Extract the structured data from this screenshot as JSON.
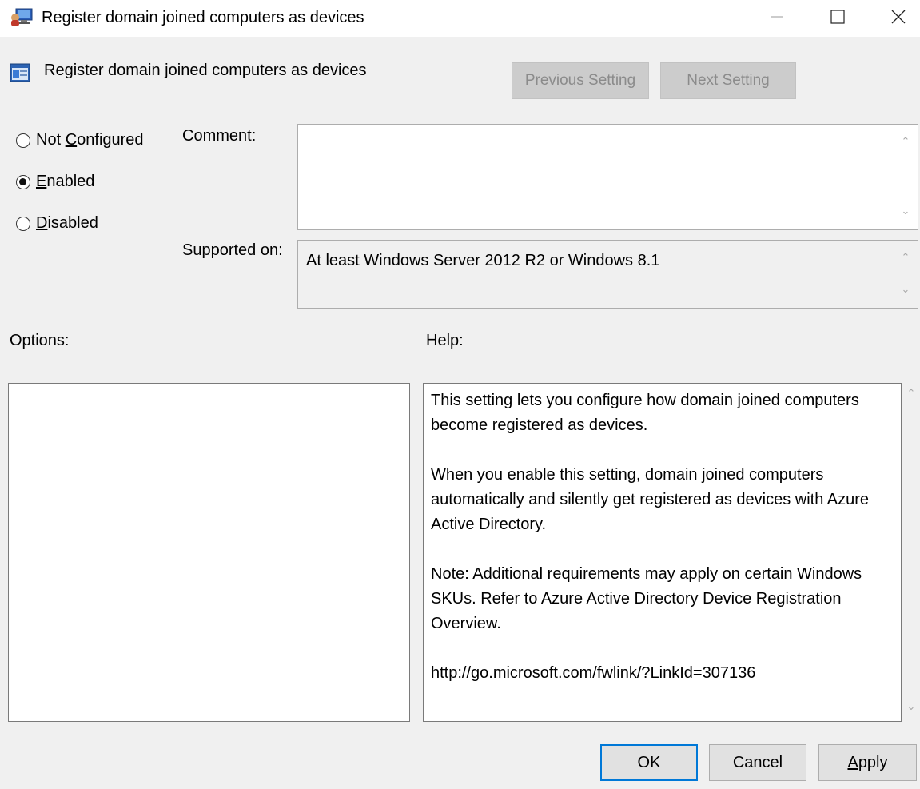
{
  "window": {
    "title": "Register domain joined computers as devices",
    "controls": {
      "minimize": "—",
      "maximize": "☐",
      "close": "✕"
    }
  },
  "header": {
    "policy_title": "Register domain joined computers as devices",
    "previous_setting": {
      "accel": "P",
      "rest": "revious Setting"
    },
    "next_setting": {
      "accel": "N",
      "rest": "ext Setting"
    }
  },
  "state": {
    "options": [
      {
        "pre": "Not ",
        "accel": "C",
        "post": "onfigured",
        "selected": false
      },
      {
        "pre": "",
        "accel": "E",
        "post": "nabled",
        "selected": true
      },
      {
        "pre": "",
        "accel": "D",
        "post": "isabled",
        "selected": false
      }
    ]
  },
  "comment": {
    "label": "Comment:",
    "value": ""
  },
  "supported": {
    "label": "Supported on:",
    "value": "At least Windows Server 2012 R2 or Windows 8.1"
  },
  "options_section": {
    "label": "Options:"
  },
  "help_section": {
    "label": "Help:",
    "paragraphs": [
      "This setting lets you configure how domain joined computers become registered as devices.",
      "When you enable this setting, domain joined computers automatically and silently get registered as devices with Azure Active Directory.",
      "Note: Additional requirements may apply on certain Windows SKUs. Refer to Azure Active Directory Device Registration Overview.",
      "http://go.microsoft.com/fwlink/?LinkId=307136"
    ]
  },
  "footer": {
    "ok": "OK",
    "cancel": "Cancel",
    "apply": {
      "accel": "A",
      "rest": "pply"
    }
  },
  "icons": {
    "app": "group-policy-computer-icon",
    "policy": "policy-setting-icon",
    "scroll_up": "scroll-up-arrow-icon",
    "scroll_down": "scroll-down-arrow-icon"
  },
  "colors": {
    "dialog_bg": "#f0f0f0",
    "default_button_border": "#0078d7",
    "disabled_button_bg": "#cccccc"
  }
}
